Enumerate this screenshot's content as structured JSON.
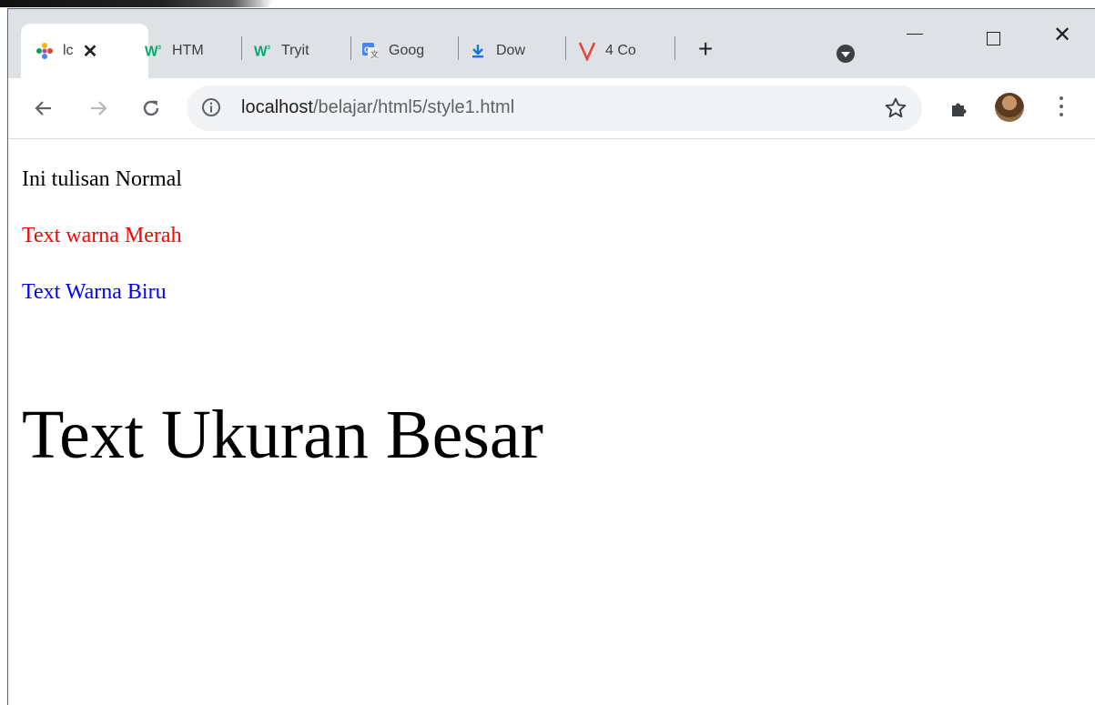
{
  "browser": {
    "tabs": [
      {
        "title": "lc",
        "icon": "localhost-favicon-icon",
        "active": true
      },
      {
        "title": "HTM",
        "icon": "w3schools-icon",
        "active": false
      },
      {
        "title": "Tryit",
        "icon": "w3schools-icon",
        "active": false
      },
      {
        "title": "Goog",
        "icon": "google-translate-icon",
        "active": false
      },
      {
        "title": "Dow",
        "icon": "download-icon",
        "active": false
      },
      {
        "title": "4 Co",
        "icon": "v-logo-icon",
        "active": false
      }
    ],
    "new_tab_label": "+",
    "close_tab_label": "✕",
    "close_window_label": "✕",
    "address": {
      "host": "localhost",
      "path": "/belajar/html5/style1.html"
    },
    "colors": {
      "tabstrip": "#dee1e6",
      "omnibox": "#f1f3f4",
      "w3_green": "#04aa6d",
      "download_blue": "#1a73e8",
      "v_red": "#e8453c"
    }
  },
  "page": {
    "lines": [
      {
        "text": "Ini tulisan Normal",
        "color": "#000000"
      },
      {
        "text": "Text warna Merah",
        "color": "#ff0000"
      },
      {
        "text": "Text Warna Biru",
        "color": "#0000ff"
      },
      {
        "text": "Text Ukuran Besar",
        "color": "#000000"
      }
    ]
  }
}
